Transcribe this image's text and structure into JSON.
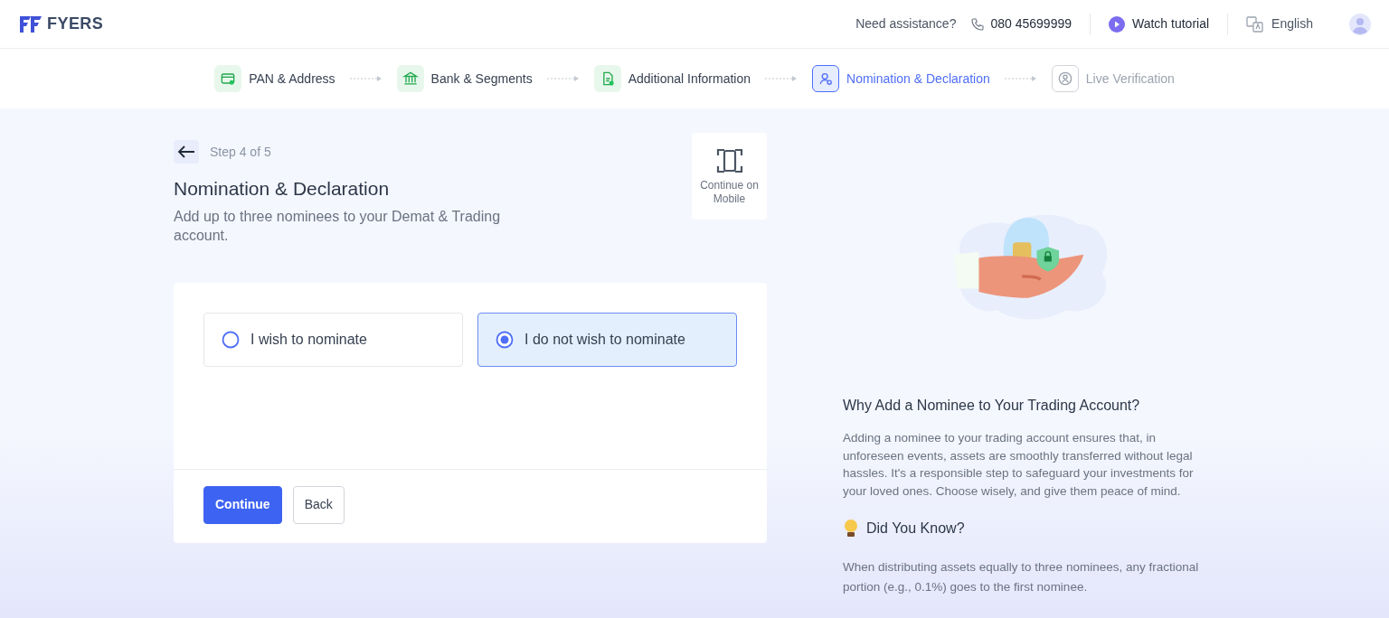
{
  "header": {
    "brand": "FYERS",
    "assistance_label": "Need assistance?",
    "phone": "080 45699999",
    "tutorial": "Watch tutorial",
    "language": "English"
  },
  "steps": [
    {
      "label": "PAN & Address",
      "completed": true,
      "selected": false
    },
    {
      "label": "Bank & Segments",
      "completed": true,
      "selected": false
    },
    {
      "label": "Additional Information",
      "completed": true,
      "selected": false
    },
    {
      "label": "Nomination & Declaration",
      "completed": false,
      "selected": true
    },
    {
      "label": "Live Verification",
      "completed": false,
      "selected": false
    }
  ],
  "form": {
    "step_label": "Step 4 of 5",
    "title": "Nomination & Declaration",
    "subtitle": "Add up to three nominees to your Demat & Trading account.",
    "mobile_label": "Continue on Mobile",
    "options": [
      {
        "label": "I wish to nominate",
        "selected": false
      },
      {
        "label": "I do not wish to nominate",
        "selected": true
      }
    ],
    "buttons": [
      {
        "label": "Continue",
        "kind": "primary"
      },
      {
        "label": "Back",
        "kind": "secondary"
      }
    ]
  },
  "info": {
    "title": "Why Add a Nominee to Your Trading Account?",
    "body": "Adding a nominee to your trading account ensures that, in unforeseen events, assets are smoothly transferred without legal hassles. It's a responsible step to safeguard your investments for your loved ones. Choose wisely, and give them peace of mind.",
    "tip_title": "Did You Know?",
    "tip_body": "When distributing assets equally to three nominees, any fractional portion (e.g., 0.1%) goes to the first nominee."
  }
}
